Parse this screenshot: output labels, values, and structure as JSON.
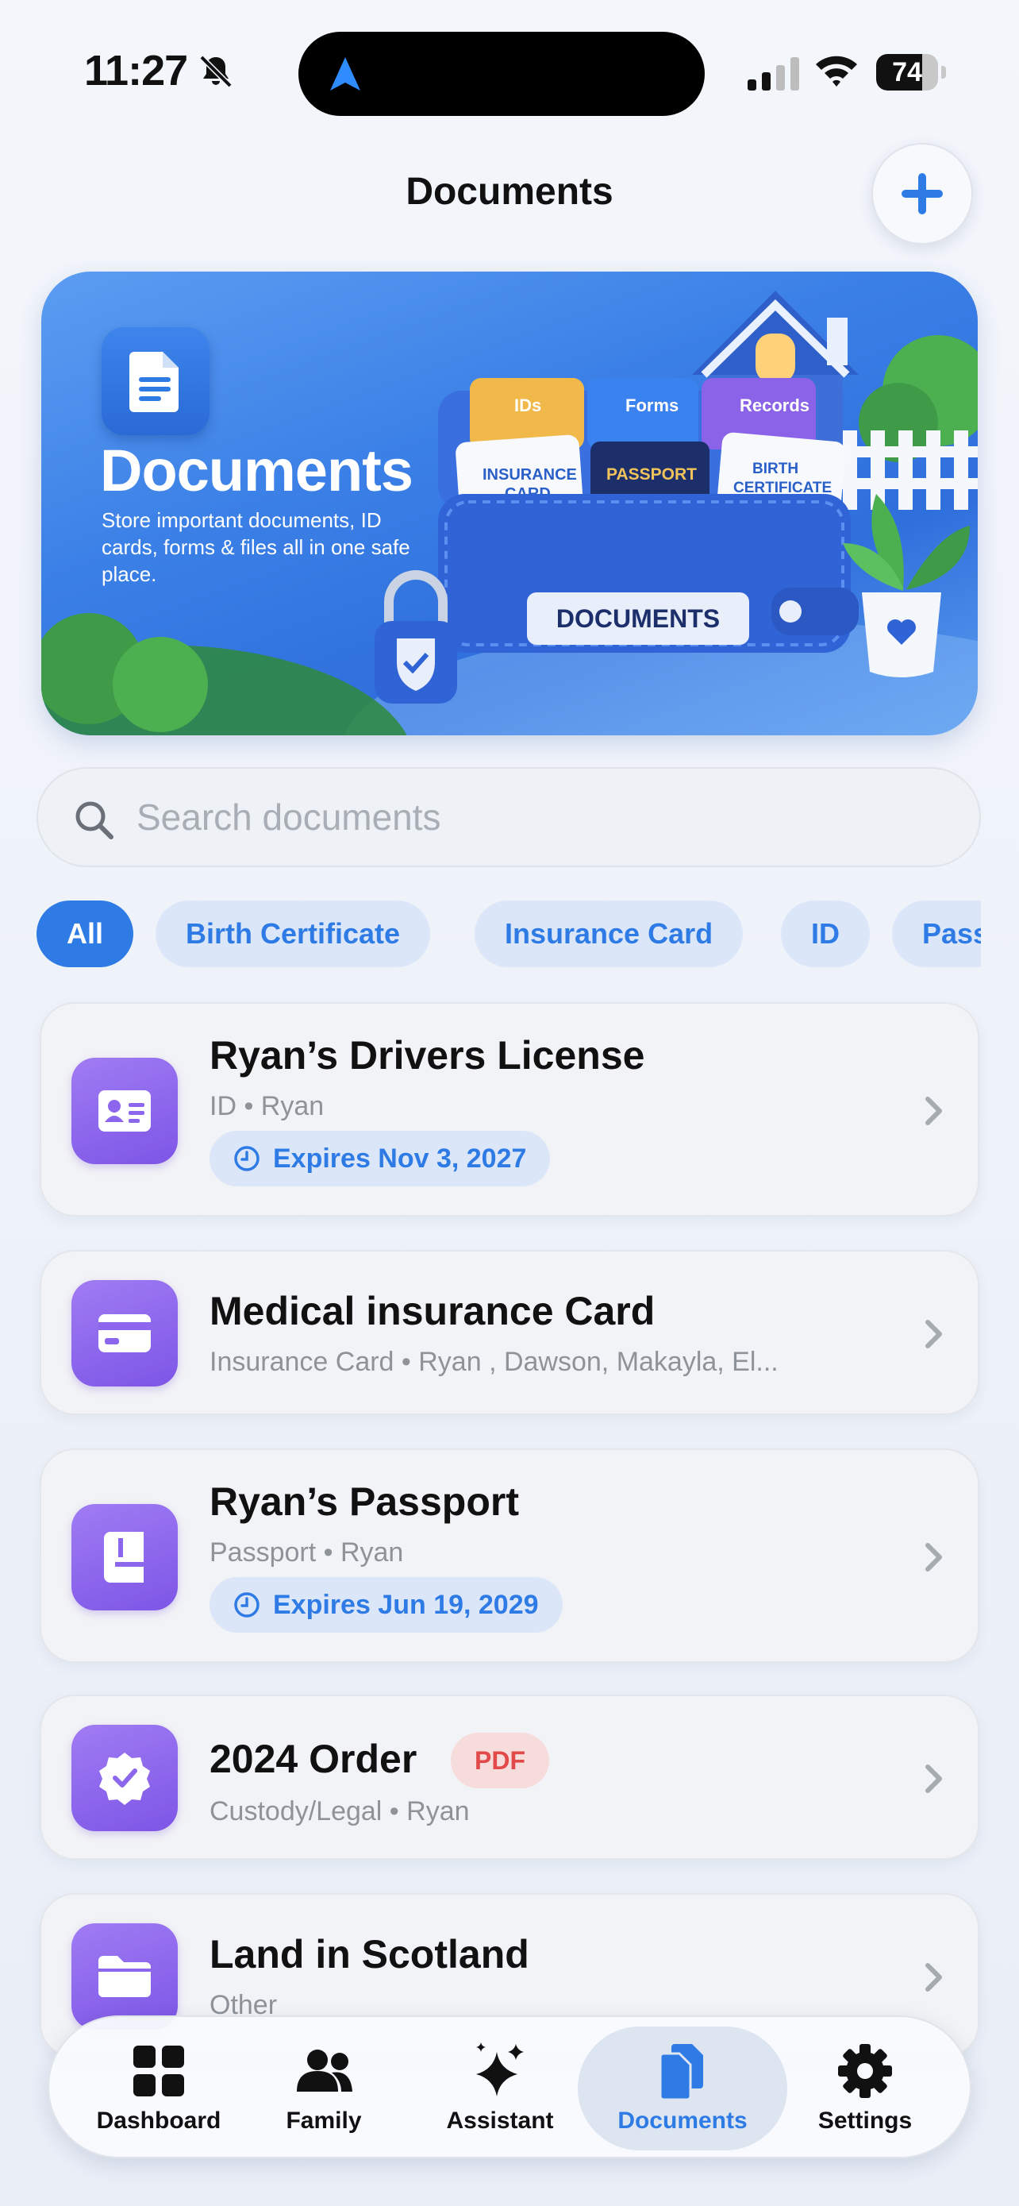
{
  "status_bar": {
    "time": "11:27",
    "battery": "74",
    "battery_level": 0.74
  },
  "header": {
    "title": "Documents"
  },
  "hero": {
    "title": "Documents",
    "subtitle": "Store important documents, ID cards, forms & files all in one safe place.",
    "illustration": {
      "tabs": [
        "IDs",
        "Forms",
        "Records"
      ],
      "cards": [
        "INSURANCE CARD",
        "PASSPORT",
        "BIRTH CERTIFICATE"
      ],
      "folder_label": "DOCUMENTS"
    }
  },
  "search": {
    "placeholder": "Search documents"
  },
  "filters": [
    {
      "label": "All",
      "active": true
    },
    {
      "label": "Birth Certificate",
      "active": false
    },
    {
      "label": "Insurance Card",
      "active": false
    },
    {
      "label": "ID",
      "active": false
    },
    {
      "label": "Pass",
      "active": false
    }
  ],
  "documents": [
    {
      "title": "Ryan’s Drivers License",
      "meta": "ID • Ryan",
      "expiry": "Expires Nov 3, 2027",
      "icon": "id-card-icon"
    },
    {
      "title": "Medical insurance Card",
      "meta": "Insurance Card • Ryan , Dawson, Makayla, El...",
      "icon": "credit-card-icon"
    },
    {
      "title": "Ryan’s Passport",
      "meta": "Passport • Ryan",
      "expiry": "Expires Jun 19, 2029",
      "icon": "book-icon"
    },
    {
      "title": "2024 Order",
      "badge": "PDF",
      "meta": "Custody/Legal • Ryan",
      "icon": "verified-badge-icon"
    },
    {
      "title": "Land in Scotland",
      "meta": "Other",
      "icon": "folder-icon"
    }
  ],
  "tabbar": [
    {
      "label": "Dashboard",
      "icon": "grid-icon",
      "active": false
    },
    {
      "label": "Family",
      "icon": "people-icon",
      "active": false
    },
    {
      "label": "Assistant",
      "icon": "sparkle-icon",
      "active": false
    },
    {
      "label": "Documents",
      "icon": "documents-icon",
      "active": true
    },
    {
      "label": "Settings",
      "icon": "gear-icon",
      "active": false
    }
  ],
  "colors": {
    "accent": "#2f7be6",
    "icon_purple": "#8c66ec",
    "pdf_red": "#e24a4a",
    "chip_bg": "#dbe7f8"
  }
}
